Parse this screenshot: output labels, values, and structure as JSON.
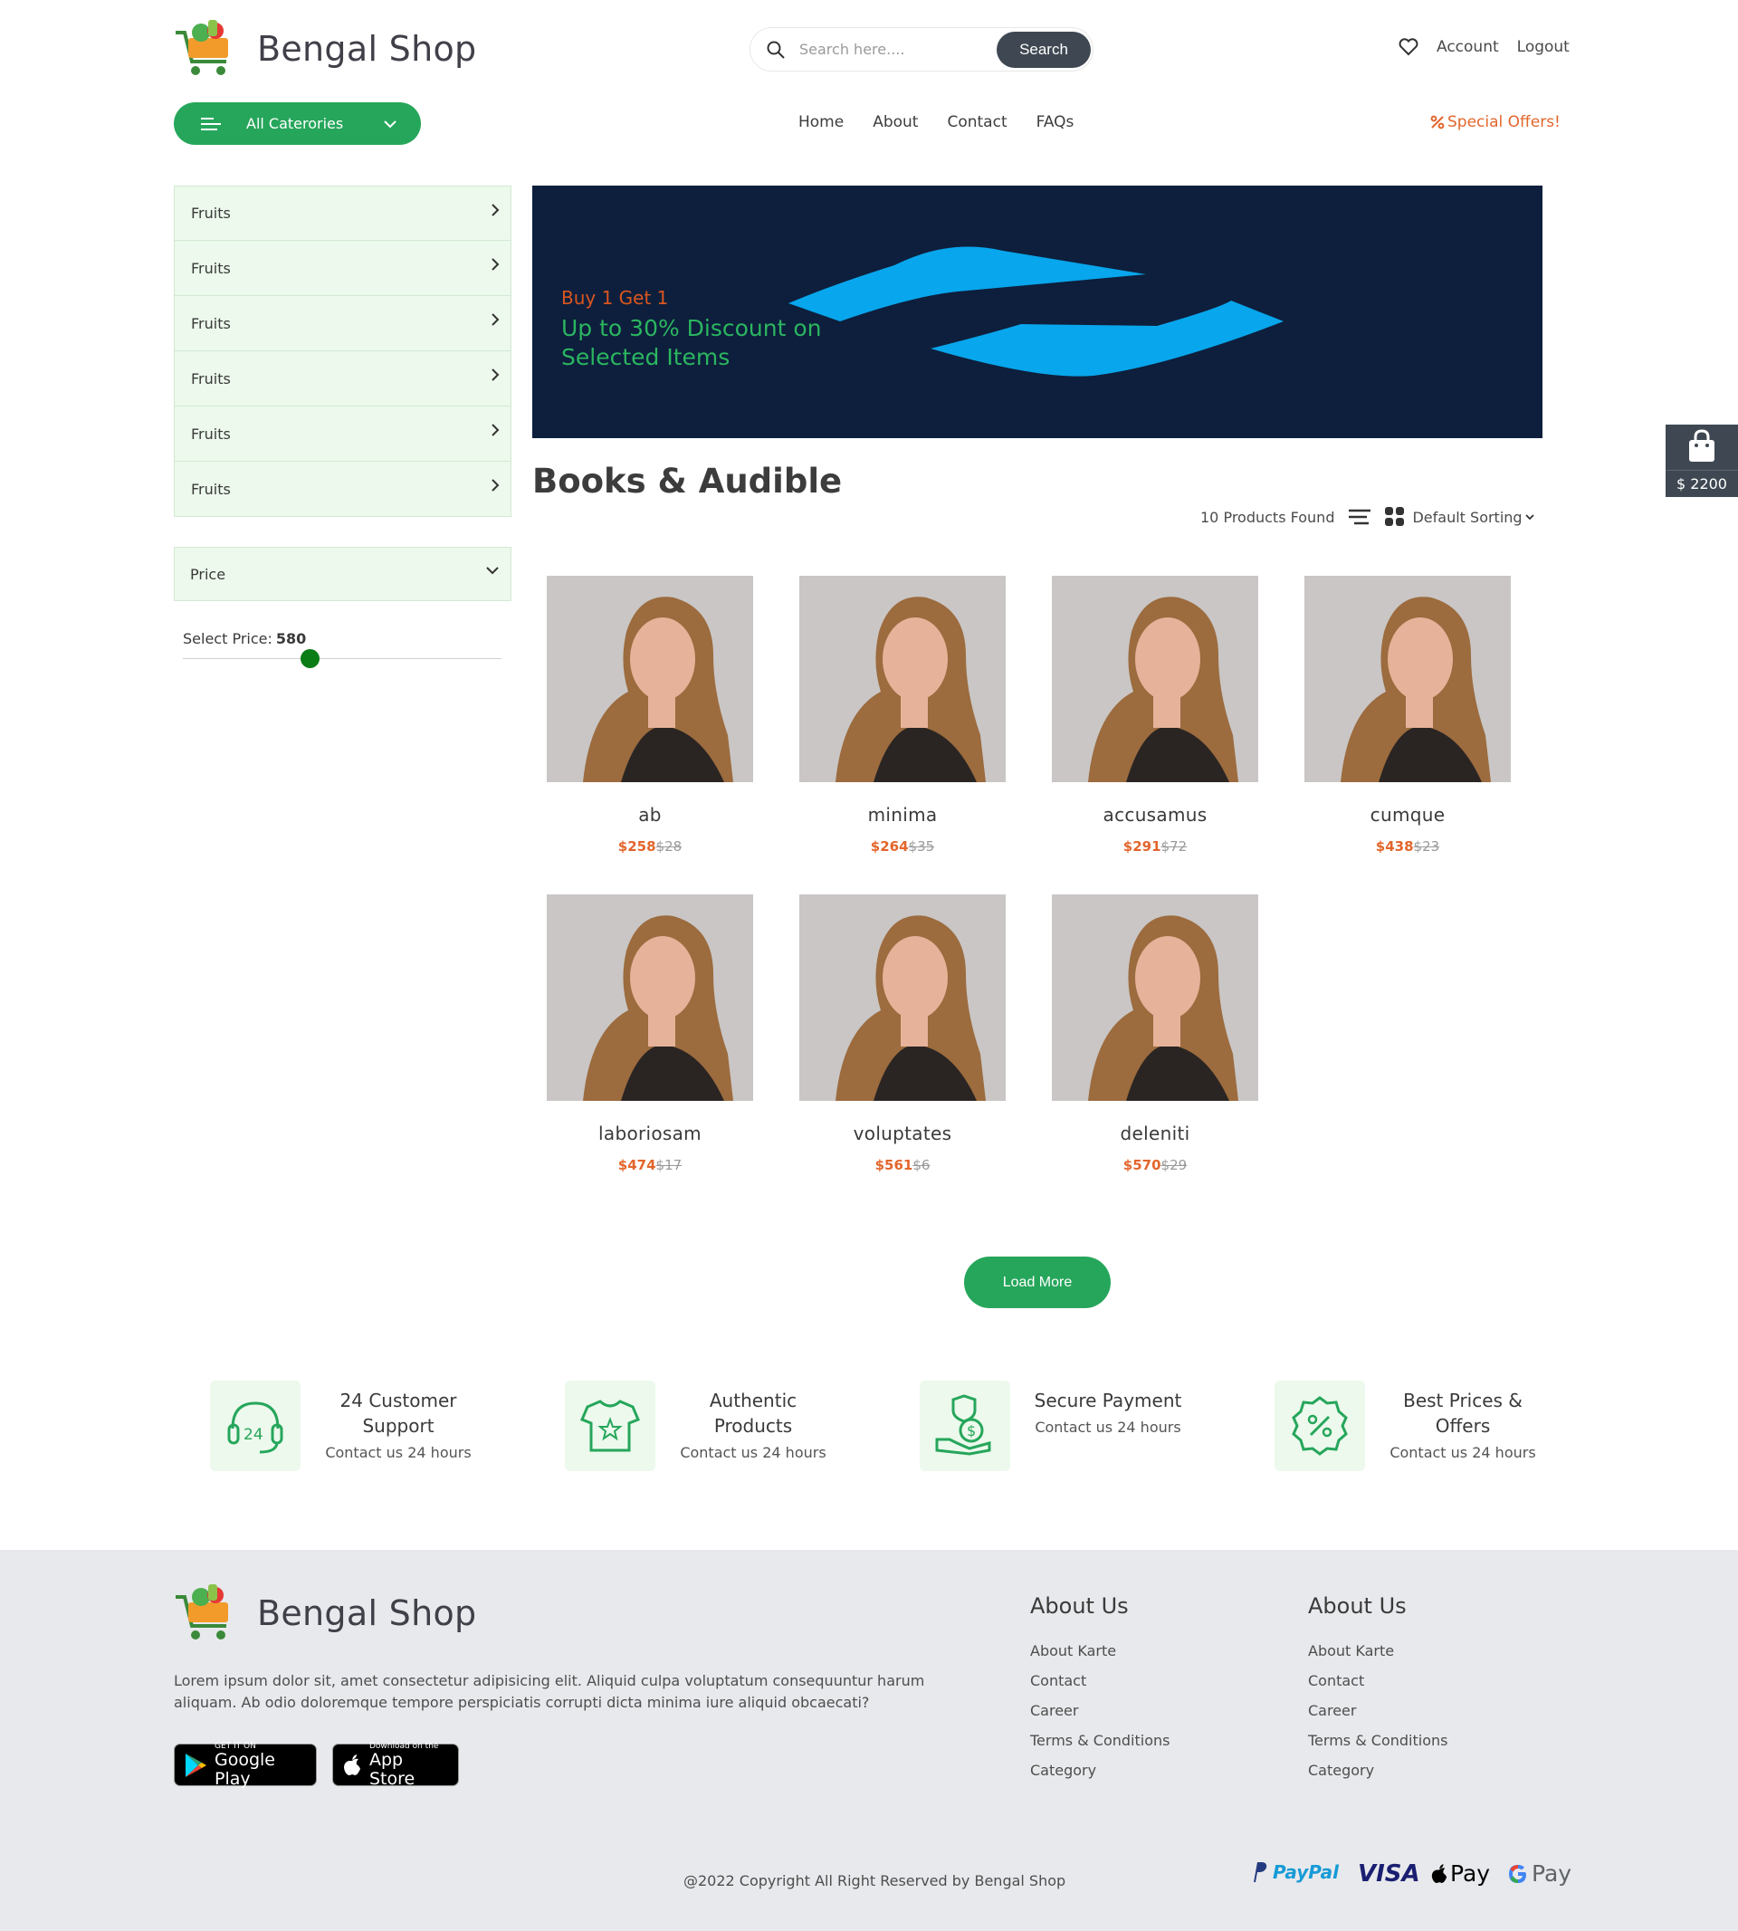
{
  "header": {
    "brand": "Bengal Shop",
    "search_placeholder": "Search here....",
    "search_button": "Search",
    "account": "Account",
    "logout": "Logout",
    "categories_button": "All Caterories",
    "nav": [
      "Home",
      "About",
      "Contact",
      "FAQs"
    ],
    "special_offers": "Special Offers!"
  },
  "sidebar": {
    "categories": [
      "Fruits",
      "Fruits",
      "Fruits",
      "Fruits",
      "Fruits",
      "Fruits"
    ],
    "price_title": "Price",
    "select_price_label": "Select Price:",
    "select_price_value": "580",
    "price_slider_fraction": 0.4
  },
  "banner": {
    "line1": "Buy 1 Get 1",
    "line2": "Up to 30% Discount on Selected Items"
  },
  "section": {
    "title": "Books & Audible",
    "products_found": "10 Products Found",
    "sorting": "Default Sorting"
  },
  "products": [
    {
      "name": "ab",
      "price": "$258",
      "old_price": "$28"
    },
    {
      "name": "minima",
      "price": "$264",
      "old_price": "$35"
    },
    {
      "name": "accusamus",
      "price": "$291",
      "old_price": "$72"
    },
    {
      "name": "cumque",
      "price": "$438",
      "old_price": "$23"
    },
    {
      "name": "laboriosam",
      "price": "$474",
      "old_price": "$17"
    },
    {
      "name": "voluptates",
      "price": "$561",
      "old_price": "$6"
    },
    {
      "name": "deleniti",
      "price": "$570",
      "old_price": "$29"
    }
  ],
  "load_more": "Load More",
  "features": [
    {
      "title": "24 Customer Support",
      "subtitle": "Contact us 24 hours",
      "icon": "headset-24-icon"
    },
    {
      "title": "Authentic Products",
      "subtitle": "Contact us 24 hours",
      "icon": "tshirt-icon"
    },
    {
      "title": "Secure Payment",
      "subtitle": "Contact us 24 hours",
      "icon": "secure-payment-icon"
    },
    {
      "title": "Best Prices & Offers",
      "subtitle": "Contact us 24 hours",
      "icon": "discount-badge-icon"
    }
  ],
  "footer": {
    "brand": "Bengal Shop",
    "description": "Lorem ipsum dolor sit, amet consectetur adipisicing elit. Aliquid culpa voluptatum consequuntur harum aliquam. Ab odio doloremque tempore perspiciatis corrupti dicta minima iure aliquid obcaecati?",
    "google_play_small": "GET IT ON",
    "google_play_big": "Google Play",
    "app_store_small": "Download on the",
    "app_store_big": "App Store",
    "col1": {
      "title": "About Us",
      "links": [
        "About Karte",
        "Contact",
        "Career",
        "Terms & Conditions",
        "Category"
      ]
    },
    "col2": {
      "title": "About Us",
      "links": [
        "About Karte",
        "Contact",
        "Career",
        "Terms & Conditions",
        "Category"
      ]
    },
    "copyright": "@2022 Copyright All Right Reserved by Bengal Shop",
    "payments": {
      "paypal": "PayPal",
      "visa": "VISA",
      "apple_pay": "Pay",
      "google_pay": "Pay"
    }
  },
  "cart": {
    "amount": "$ 2200"
  },
  "colors": {
    "accent": "#26a65b",
    "orange": "#e3662c",
    "dark": "#3f4852",
    "banner_bg": "#0d1f3c",
    "banner_shape": "#08a6ec"
  }
}
